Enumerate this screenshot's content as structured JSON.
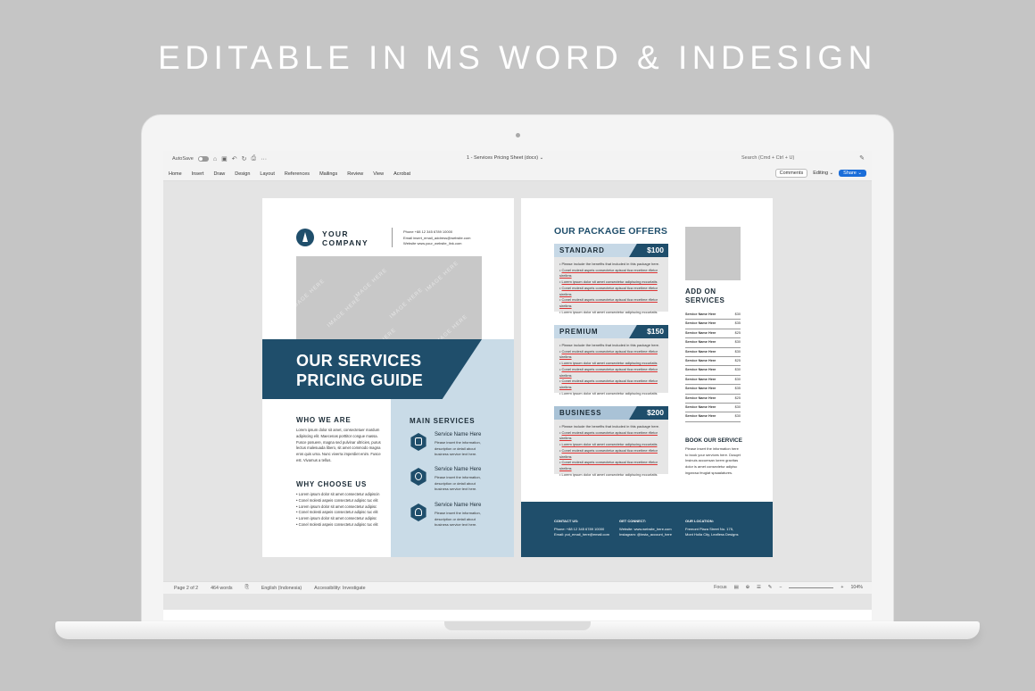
{
  "headline": "EDITABLE IN MS WORD & INDESIGN",
  "word": {
    "autosave_label": "AutoSave",
    "doc_title": "1 - Services Pricing Sheet (docx) ⌄",
    "search_placeholder": "Search (Cmd + Ctrl + U)",
    "tabs": [
      "Home",
      "Insert",
      "Draw",
      "Design",
      "Layout",
      "References",
      "Mailings",
      "Review",
      "View",
      "Acrobat"
    ],
    "comments_label": "Comments",
    "editing_label": "Editing ⌄",
    "share_label": "Share ⌄",
    "status": {
      "page": "Page 2 of 2",
      "words": "464 words",
      "language": "English (Indonesia)",
      "accessibility": "Accessibility: Investigate",
      "focus": "Focus",
      "zoom": "104%"
    }
  },
  "page1": {
    "company": "YOUR COMPANY",
    "contact_lines": [
      "Phone  +88 12 345 6789 10000",
      "Email  insert_email_address@website.com",
      "Website  www.your_website_link.com"
    ],
    "image_placeholder": "IMAGE HERE",
    "band_title_1": "OUR SERVICES",
    "band_title_2": "PRICING GUIDE",
    "who_heading": "WHO WE ARE",
    "who_text": [
      "Lorem ipsum dolor sit amet, consectetuer mardum",
      "adipiscing elit. Maecenas porttitor congue massa.",
      "Fusce posuere, magna sed pulvinar ultricies, purus",
      "lectus malesuada libero, sit amet commodo magna",
      "eros quis urna. Nunc viverra imperdiet enim. Fusce",
      "est. Vivamus a tellus."
    ],
    "why_heading": "WHY CHOOSE US",
    "why_bullets": [
      "Lorem ipsum dolor sit amet consectetur adipiscin",
      "Conel molesti aspeis consectetur adipisc tuc elit",
      "Lorem ipsum dolor sit amet consectetur adipisc",
      "Conel molesti aspeis consectetur adipisc tuc elit",
      "Lorem ipsum dolor sit amet consectetur adipisc",
      "Conel molesti aspeis consectetur adipisc tuc elit"
    ],
    "main_heading": "MAIN SERVICES",
    "services": [
      {
        "name": "Service Name Here",
        "desc": [
          "Please insert the information,",
          "description or detail about",
          "business service text here."
        ]
      },
      {
        "name": "Service Name Here",
        "desc": [
          "Please insert the information,",
          "description or detail about",
          "business service text here."
        ]
      },
      {
        "name": "Service Name Here",
        "desc": [
          "Please insert the information,",
          "description or detail about",
          "business service text here."
        ]
      }
    ]
  },
  "page2": {
    "packages_heading": "OUR PACKAGE OFFERS",
    "packages": [
      {
        "name": "STANDARD",
        "price": "$100"
      },
      {
        "name": "PREMIUM",
        "price": "$150"
      },
      {
        "name": "BUSINESS",
        "price": "$200"
      }
    ],
    "package_items": [
      "Please include the benefits that included in this package here.",
      "Conel molesti aspeis consectetur apiscal tica recetime rfletor sirelims",
      "Lorem ipsum dolor sit amet consectetur adipiscing eccurlatis",
      "Conel molesti aspeis consectetur apiscal tica recetime rfletor sirelims",
      "Conel molesti aspeis consectetur apiscal tica recetime rfletor sirelims",
      "Lorem ipsum dolor sit amet consectetur adipiscing eccurlatis"
    ],
    "addon_heading_1": "ADD ON",
    "addon_heading_2": "SERVICES",
    "addons": [
      {
        "name": "Service Name Here",
        "price": "$30"
      },
      {
        "name": "Service Name Here",
        "price": "$35"
      },
      {
        "name": "Service Name Here",
        "price": "$25"
      },
      {
        "name": "Service Name Here",
        "price": "$30"
      },
      {
        "name": "Service Name Here",
        "price": "$30"
      },
      {
        "name": "Service Name Here",
        "price": "$25"
      },
      {
        "name": "Service Name Here",
        "price": "$30"
      },
      {
        "name": "Service Name Here",
        "price": "$30"
      },
      {
        "name": "Service Name Here",
        "price": "$35"
      },
      {
        "name": "Service Name Here",
        "price": "$25"
      },
      {
        "name": "Service Name Here",
        "price": "$30"
      },
      {
        "name": "Service Name Here",
        "price": "$30"
      }
    ],
    "book_heading": "BOOK OUR SERVICE",
    "book_text": [
      "Please insert the information here",
      "to book your services here. Dusqet",
      "Insinuis accumsan lorem gravitas",
      "dolor is amet consectetur adipisc",
      "ingarcsa feugiat spsaalatures."
    ],
    "footer": {
      "contact_heading": "CONTACT US:",
      "contact_lines": [
        "Phone:   +88 12 345 6789 10000",
        "Email:   put_email_here@email.com"
      ],
      "connect_heading": "GET CONNECT:",
      "connect_lines": [
        "Website:  www.website_here.com",
        "Instagram:  @insta_account_here"
      ],
      "location_heading": "OUR LOCATION:",
      "location_lines": [
        "Fremont Plaza Street No. 175,",
        "Mont Holla City, Leafless Designs"
      ]
    }
  }
}
